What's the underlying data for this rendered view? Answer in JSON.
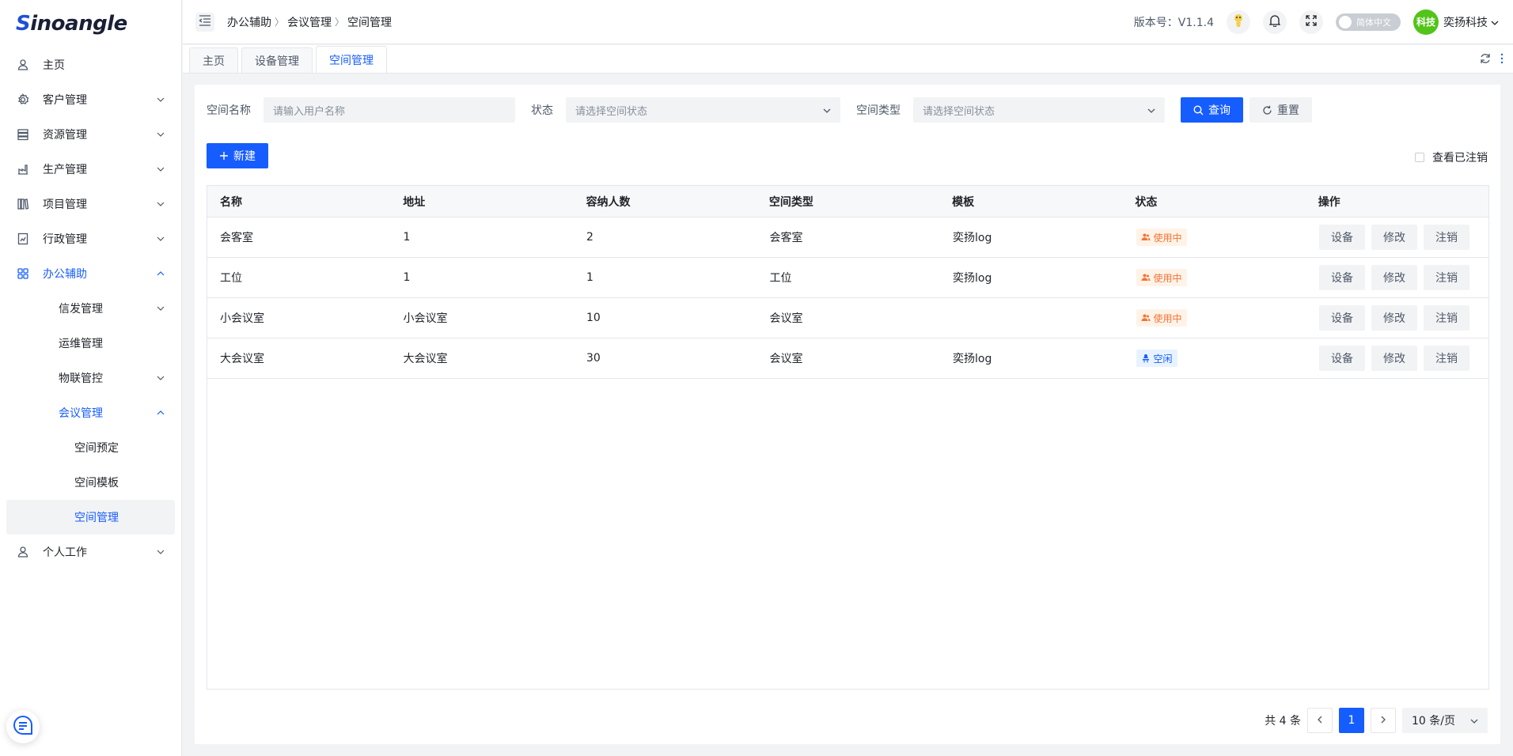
{
  "logo": {
    "s": "S",
    "rest": "inoangle"
  },
  "sidebar": {
    "items": [
      {
        "label": "主页"
      },
      {
        "label": "客户管理"
      },
      {
        "label": "资源管理"
      },
      {
        "label": "生产管理"
      },
      {
        "label": "项目管理"
      },
      {
        "label": "行政管理"
      },
      {
        "label": "办公辅助"
      },
      {
        "label": "信发管理"
      },
      {
        "label": "运维管理"
      },
      {
        "label": "物联管控"
      },
      {
        "label": "会议管理"
      },
      {
        "label": "空间预定"
      },
      {
        "label": "空间模板"
      },
      {
        "label": "空间管理"
      },
      {
        "label": "个人工作"
      }
    ]
  },
  "header": {
    "breadcrumb": [
      "办公辅助",
      "会议管理",
      "空间管理"
    ],
    "version": "版本号：V1.1.4",
    "language": "简体中文",
    "avatar_text": "科技",
    "username": "奕扬科技"
  },
  "tabs": [
    {
      "label": "主页"
    },
    {
      "label": "设备管理"
    },
    {
      "label": "空间管理"
    }
  ],
  "filters": {
    "name_label": "空间名称",
    "name_placeholder": "请输入用户名称",
    "status_label": "状态",
    "status_placeholder": "请选择空间状态",
    "type_label": "空间类型",
    "type_placeholder": "请选择空间状态",
    "query_label": "查询",
    "reset_label": "重置"
  },
  "toolbar": {
    "new_label": "新建",
    "show_cancelled": "查看已注销"
  },
  "table": {
    "columns": [
      "名称",
      "地址",
      "容纳人数",
      "空间类型",
      "模板",
      "状态",
      "操作"
    ],
    "rows": [
      {
        "name": "会客室",
        "address": "1",
        "capacity": "2",
        "type": "会客室",
        "template": "奕扬log",
        "status": "使用中"
      },
      {
        "name": "工位",
        "address": "1",
        "capacity": "1",
        "type": "工位",
        "template": "奕扬log",
        "status": "使用中"
      },
      {
        "name": "小会议室",
        "address": "小会议室",
        "capacity": "10",
        "type": "会议室",
        "template": "",
        "status": "使用中"
      },
      {
        "name": "大会议室",
        "address": "大会议室",
        "capacity": "30",
        "type": "会议室",
        "template": "奕扬log",
        "status": "空闲"
      }
    ],
    "ops": {
      "device": "设备",
      "edit": "修改",
      "cancel": "注销"
    }
  },
  "pagination": {
    "total": "共 4 条",
    "current_page": "1",
    "page_size": "10 条/页"
  },
  "colors": {
    "primary": "#165dff",
    "in_use": "#f77234",
    "idle": "#165dff",
    "avatar": "#52c41a"
  }
}
